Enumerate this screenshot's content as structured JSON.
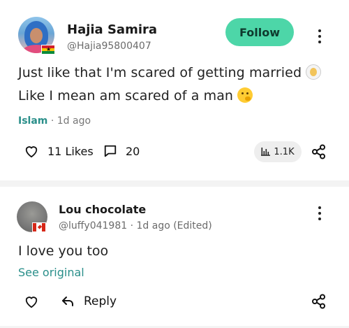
{
  "post": {
    "author_name": "Hajia Samira",
    "author_handle": "@Hajia95800407",
    "follow_label": "Follow",
    "line1": "Just like that I'm scared of getting married",
    "line2": "Like I mean am scared of a man",
    "tag": "Islam",
    "time": " · 1d ago",
    "likes": "11 Likes",
    "comments": "20",
    "views": "1.1K",
    "emoji_1": "bride-with-veil-emoji",
    "emoji_2": "thinking-face-emoji",
    "flag": "ghana-flag-icon"
  },
  "comment": {
    "author_name": "Lou chocolate",
    "author_handle": "@luffy041981",
    "time_edited": " · 1d ago (Edited)",
    "text": "I love you too",
    "see_original": "See original",
    "reply_label": "Reply",
    "flag": "canada-flag-icon"
  },
  "colors": {
    "follow_bg": "#4dd6a8",
    "accent_teal": "#2a8f8a",
    "divider": "#f3f3f3"
  }
}
